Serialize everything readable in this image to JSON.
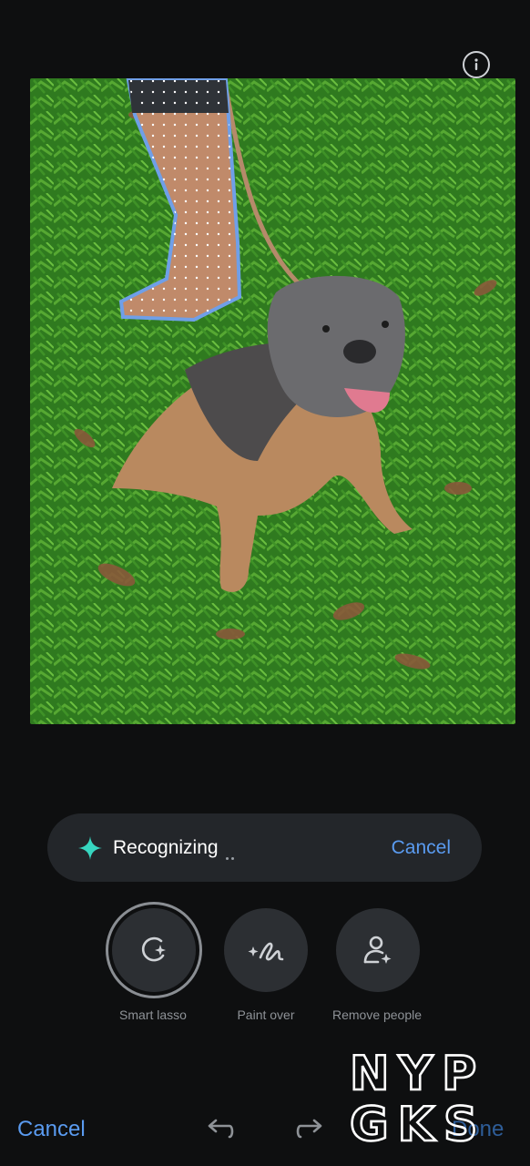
{
  "status": {
    "text": "Recognizing",
    "cancel_label": "Cancel"
  },
  "tools": [
    {
      "label": "Smart lasso",
      "icon": "smart-lasso-icon",
      "active": true
    },
    {
      "label": "Paint over",
      "icon": "paint-over-icon",
      "active": false
    },
    {
      "label": "Remove people",
      "icon": "remove-people-icon",
      "active": false
    }
  ],
  "bottom_bar": {
    "cancel_label": "Cancel",
    "done_label": "Done"
  },
  "watermark": {
    "line1": "NYP",
    "line2": "GKS"
  },
  "colors": {
    "accent": "#5a9bf0",
    "selection_outline": "#6f9fe8",
    "background": "#0e0f10"
  }
}
